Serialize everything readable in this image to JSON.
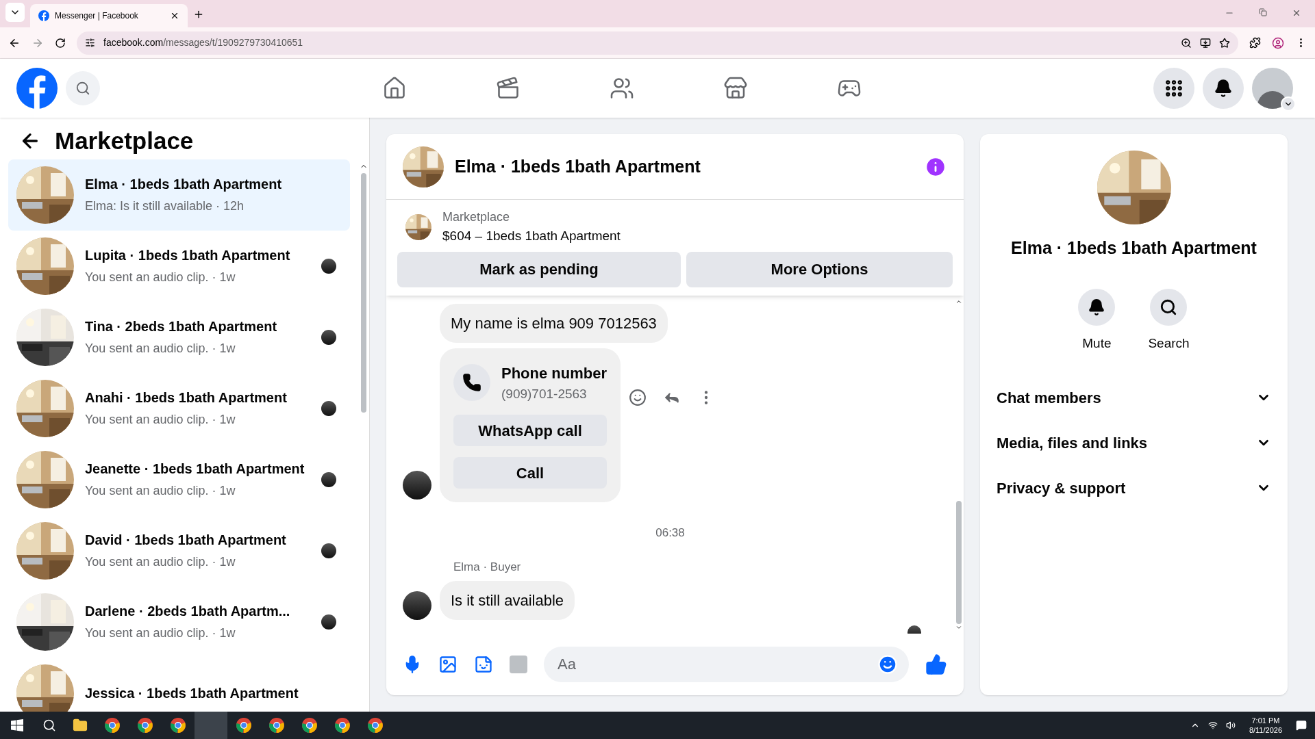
{
  "browser": {
    "tab_title": "Messenger | Facebook",
    "url_host": "facebook.com",
    "url_path": "/messages/t/1909279730410651"
  },
  "sidebar": {
    "title": "Marketplace",
    "conversations": [
      {
        "name": "Elma · 1beds 1bath Apartment",
        "preview": "Elma: Is it still available · 12h",
        "selected": true
      },
      {
        "name": "Lupita · 1beds 1bath Apartment",
        "preview": "You sent an audio clip. · 1w",
        "selected": false
      },
      {
        "name": "Tina · 2beds 1bath Apartment",
        "preview": "You sent an audio clip. · 1w",
        "selected": false
      },
      {
        "name": "Anahi · 1beds 1bath Apartment",
        "preview": "You sent an audio clip. · 1w",
        "selected": false
      },
      {
        "name": "Jeanette · 1beds 1bath Apartment",
        "preview": "You sent an audio clip. · 1w",
        "selected": false
      },
      {
        "name": "David · 1beds 1bath Apartment",
        "preview": "You sent an audio clip. · 1w",
        "selected": false
      },
      {
        "name": "Darlene · 2beds 1bath Apartm...",
        "preview": "You sent an audio clip. · 1w",
        "selected": false
      },
      {
        "name": "Jessica · 1beds 1bath Apartment",
        "selected": false
      }
    ]
  },
  "chat": {
    "title": "Elma · 1beds 1bath Apartment",
    "listing": {
      "label": "Marketplace",
      "price": "$604 – 1beds 1bath Apartment"
    },
    "listing_buttons": [
      "Mark as pending",
      "More Options"
    ],
    "messages": [
      {
        "kind": "text",
        "text": "My name is elma 909 7012563"
      },
      {
        "kind": "contact",
        "title": "Phone number",
        "number": "(909)701-2563",
        "buttons": [
          "WhatsApp call",
          "Call"
        ]
      },
      {
        "kind": "time",
        "text": "06:38"
      },
      {
        "kind": "sender",
        "text": "Elma · Buyer"
      },
      {
        "kind": "text",
        "text": "Is it still available"
      }
    ],
    "composer": {
      "placeholder": "Aa"
    }
  },
  "details": {
    "name": "Elma · 1beds 1bath Apartment",
    "actions": [
      {
        "kind": "mute",
        "label": "Mute"
      },
      {
        "kind": "search",
        "label": "Search"
      }
    ],
    "sections": [
      {
        "label": "Chat members",
        "expanded": false
      },
      {
        "label": "Media, files and links",
        "expanded": false
      },
      {
        "label": "Privacy & support",
        "expanded": false
      }
    ]
  },
  "taskbar": {
    "time": "7:01 PM",
    "date": "8/11/2026"
  }
}
